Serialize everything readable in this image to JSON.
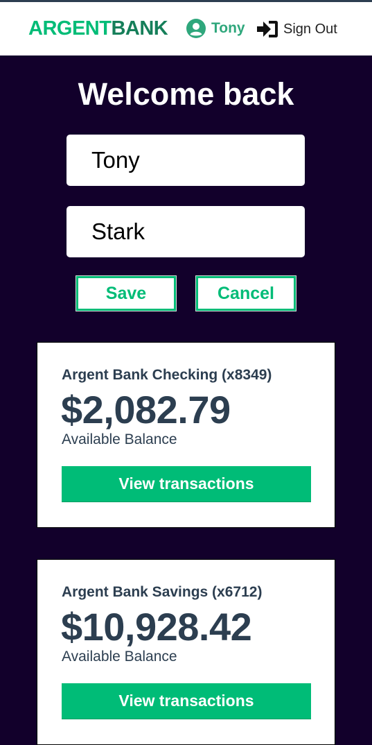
{
  "brand": {
    "logo_part1": "ARGENT",
    "logo_part2": "BANK",
    "color_primary": "#00bc77",
    "color_dark": "#12002b"
  },
  "nav": {
    "user_icon": "user-circle-icon",
    "user_name": "Tony",
    "signout_icon": "sign-out-icon",
    "signout_label": "Sign Out"
  },
  "header": {
    "title": "Welcome back"
  },
  "edit_form": {
    "first_name": "Tony",
    "last_name": "Stark",
    "save_label": "Save",
    "cancel_label": "Cancel"
  },
  "accounts": [
    {
      "title": "Argent Bank Checking (x8349)",
      "amount": "$2,082.79",
      "description": "Available Balance",
      "button_label": "View transactions"
    },
    {
      "title": "Argent Bank Savings (x6712)",
      "amount": "$10,928.42",
      "description": "Available Balance",
      "button_label": "View transactions"
    }
  ]
}
